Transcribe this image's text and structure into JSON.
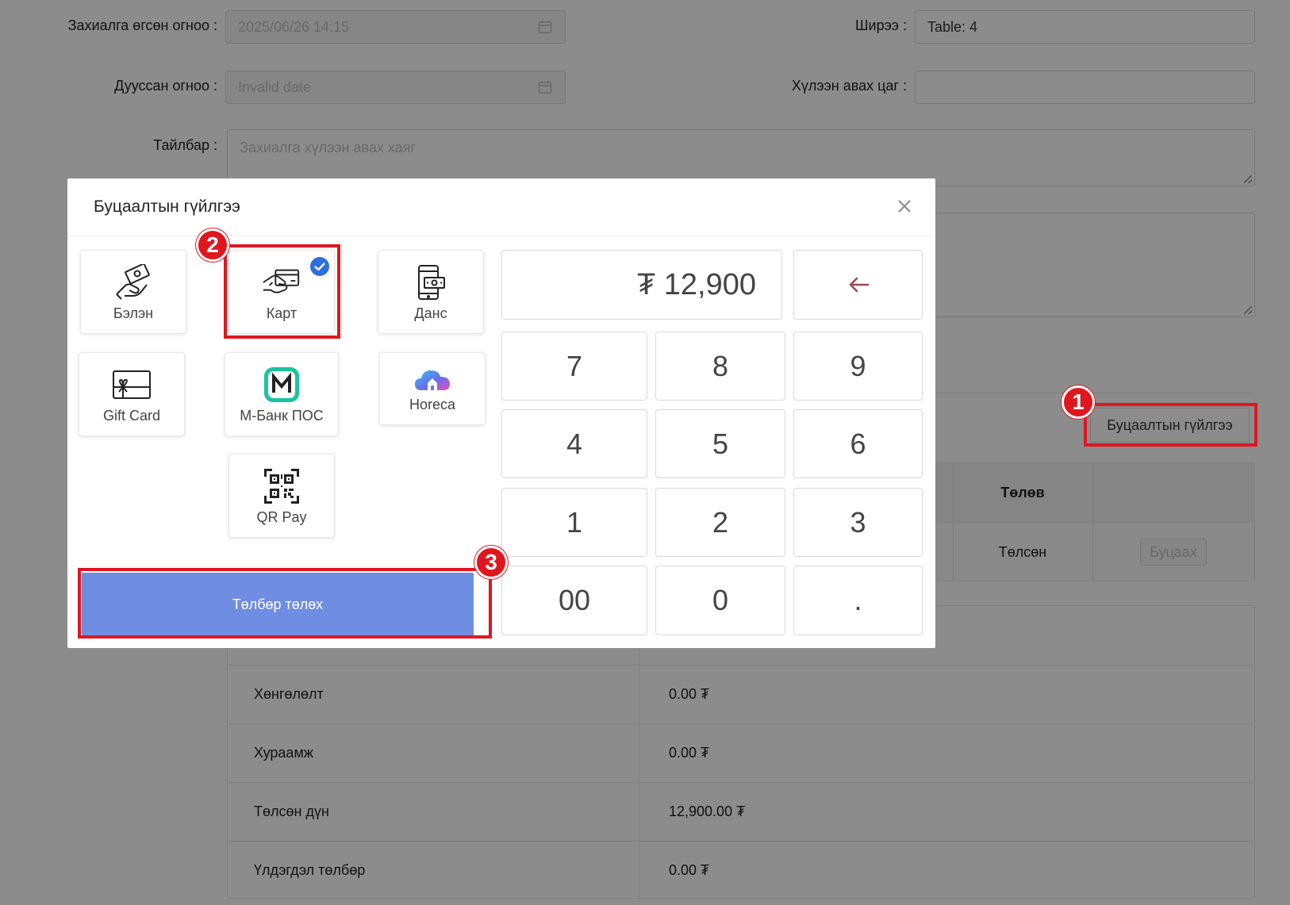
{
  "form": {
    "order_date_label": "Захиалга өгсөн огноо",
    "order_date_value": "2025/06/26 14:15",
    "end_date_label": "Дууссан огноо",
    "end_date_value": "Invalid date",
    "table_label": "Ширээ",
    "table_value": "Table: 4",
    "delivery_time_label": "Хүлээн авах цаг",
    "delivery_time_value": "",
    "note_label": "Тайлбар",
    "note_placeholder": "Захиалга хүлээн авах хаяг"
  },
  "refund_button_label": "Буцаалтын гүйлгээ",
  "payments_table": {
    "header_status": "Төлөв",
    "row_status": "Төлсөн",
    "row_action": "Буцаах"
  },
  "summary": [
    {
      "label": "Хөнгөлөлт",
      "value": "0.00 ₮"
    },
    {
      "label": "Хураамж",
      "value": "0.00 ₮"
    },
    {
      "label": "Төлсөн дүн",
      "value": "12,900.00 ₮"
    },
    {
      "label": "Үлдэгдэл төлбөр",
      "value": "0.00 ₮"
    }
  ],
  "modal": {
    "title": "Буцаалтын гүйлгээ",
    "methods": {
      "cash": "Бэлэн",
      "card": "Карт",
      "account": "Данс",
      "giftcard": "Gift Card",
      "mbank": "М-Банк ПОС",
      "horeca": "Horeca",
      "qrpay": "QR Pay"
    },
    "selected_method": "card",
    "amount": "₮ 12,900",
    "keys": {
      "k7": "7",
      "k8": "8",
      "k9": "9",
      "k4": "4",
      "k5": "5",
      "k6": "6",
      "k1": "1",
      "k2": "2",
      "k3": "3",
      "k00": "00",
      "k0": "0",
      "kdot": "."
    },
    "pay_button": "Төлбөр төлөх"
  },
  "annotations": {
    "b1": "1",
    "b2": "2",
    "b3": "3"
  },
  "colors": {
    "accent": "#6f8de2",
    "check": "#2f6fde",
    "annotation_red": "#e0161f",
    "backspace": "#a3474f"
  }
}
